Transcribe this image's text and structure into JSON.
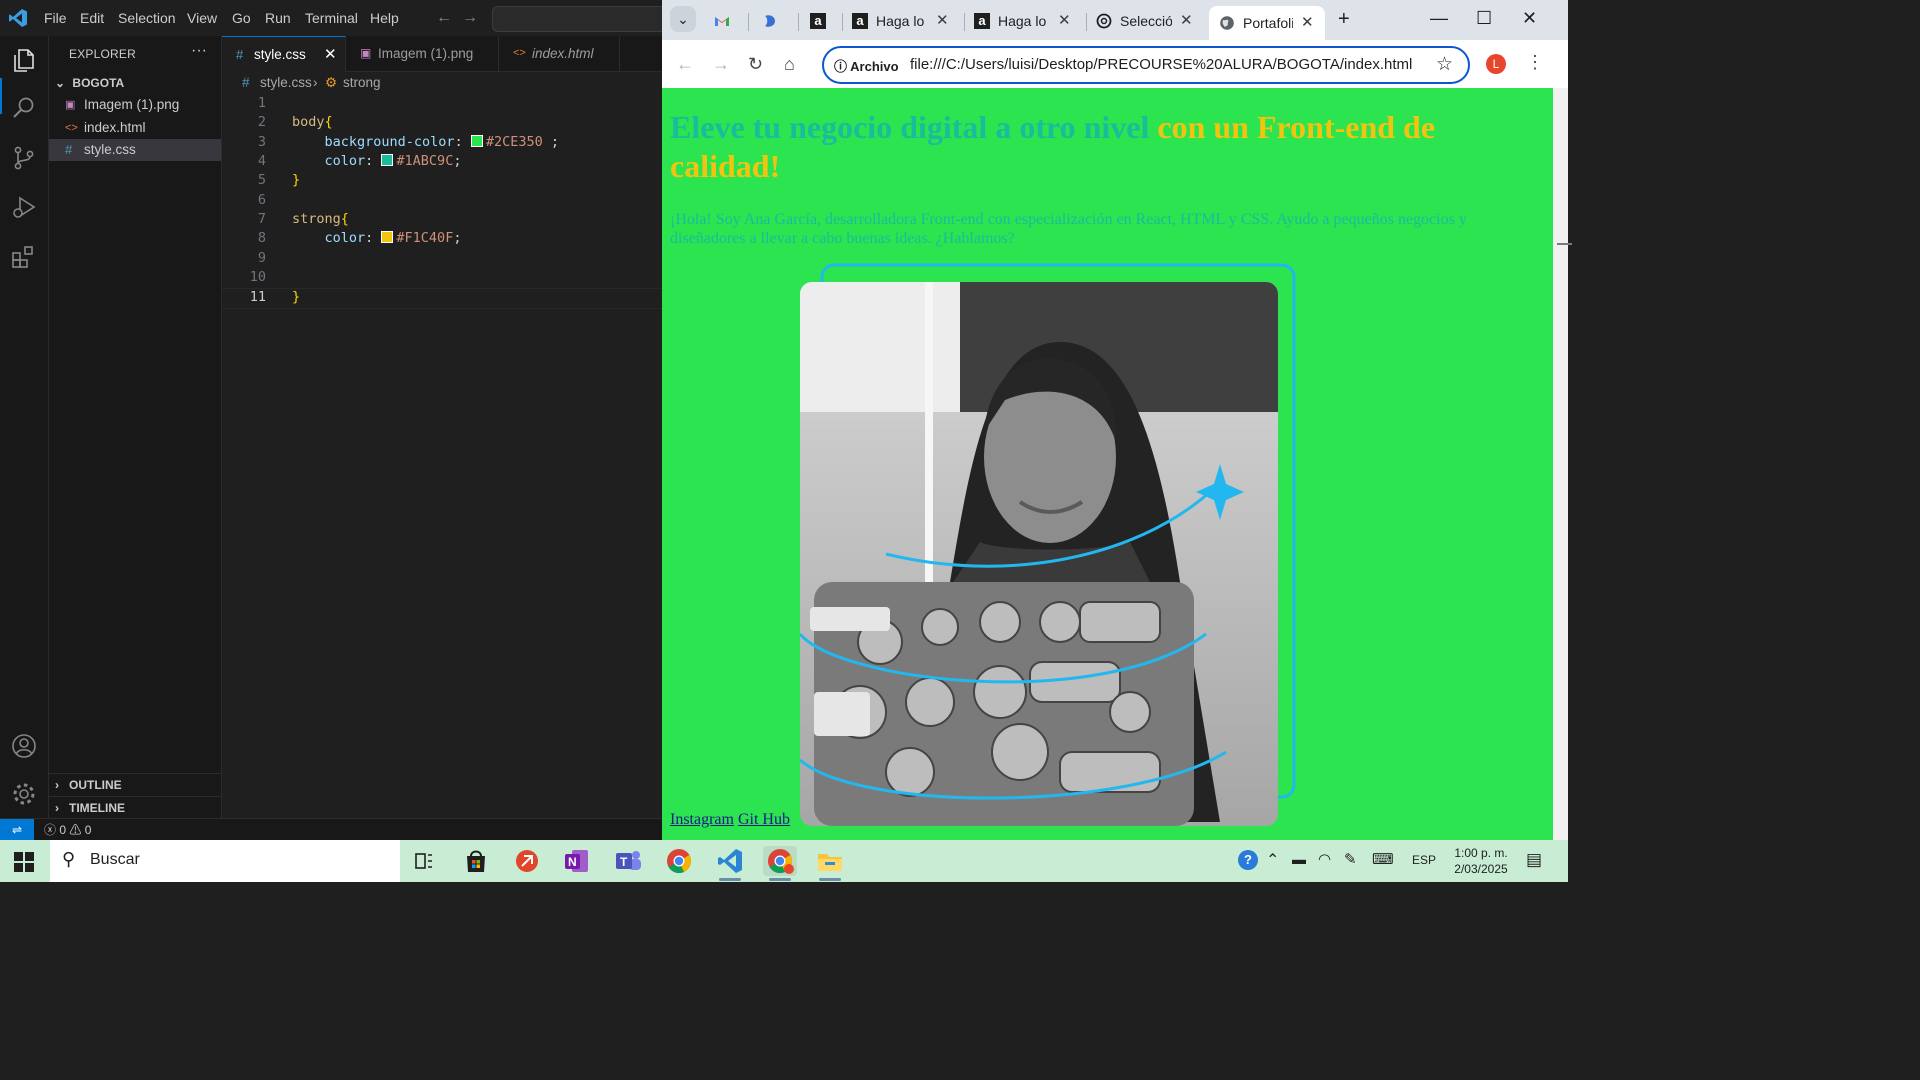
{
  "vscode": {
    "menu": [
      "File",
      "Edit",
      "Selection",
      "View",
      "Go",
      "Run",
      "Terminal",
      "Help"
    ],
    "explorer": {
      "title": "EXPLORER",
      "more": "···",
      "folder": "BOGOTA",
      "files": [
        {
          "name": "Imagem (1).png",
          "icon": "image-file-icon"
        },
        {
          "name": "index.html",
          "icon": "html-file-icon"
        },
        {
          "name": "style.css",
          "icon": "css-file-icon",
          "selected": true
        }
      ],
      "sections": [
        "OUTLINE",
        "TIMELINE"
      ]
    },
    "tabs": [
      {
        "label": "style.css",
        "icon": "css-file-icon",
        "active": true
      },
      {
        "label": "Imagem (1).png",
        "icon": "image-file-icon"
      },
      {
        "label": "index.html",
        "icon": "html-file-icon"
      }
    ],
    "breadcrumb": {
      "file": "style.css",
      "symbol": "strong"
    },
    "code": {
      "line_numbers": [
        "1",
        "2",
        "3",
        "4",
        "5",
        "6",
        "7",
        "8",
        "9",
        "10",
        "11"
      ],
      "l2_selector": "body",
      "l3_prop": "background-color",
      "l3_value": "#2CE350",
      "l3_color": "#2CE350",
      "l4_prop": "color",
      "l4_value": "#1ABC9C",
      "l4_color": "#1ABC9C",
      "l7_selector": "strong",
      "l8_prop": "color",
      "l8_value": "#F1C40F",
      "l8_color": "#F1C40F",
      "active_line": "11"
    },
    "status": {
      "errors": "0",
      "warnings": "0"
    }
  },
  "chrome": {
    "tabs": [
      {
        "title": "",
        "icon": "gmail-icon"
      },
      {
        "title": "",
        "icon": "copilot-icon"
      },
      {
        "title": "",
        "icon": "alura-icon"
      },
      {
        "title": "Haga lo c",
        "icon": "alura-icon"
      },
      {
        "title": "Haga lo c",
        "icon": "alura-icon"
      },
      {
        "title": "Selección",
        "icon": "openai-icon"
      },
      {
        "title": "Portafolio",
        "icon": "globe-icon",
        "active": true
      }
    ],
    "site_info": "Archivo",
    "url": "file:///C:/Users/luisi/Desktop/PRECOURSE%20ALURA/BOGOTA/index.html",
    "profile_initial": "L"
  },
  "page": {
    "headline": "Eleve tu negocio digital a otro nivel ",
    "headline_strong": "con un Front-end de calidad!",
    "paragraph": "¡Hola! Soy Ana García, desarrolladora Front-end con especialización en React, HTML y CSS. Ayudo a pequeños negocios y diseñadores a llevar a cabo buenas ideas. ¿Hablamos?",
    "links": [
      "Instagram",
      "Git Hub"
    ],
    "colors": {
      "background": "#2CE350",
      "text": "#1ABC9C",
      "strong": "#F1C40F",
      "frame": "#22b8ef"
    }
  },
  "taskbar": {
    "search": "Buscar",
    "language": "ESP",
    "time": "1:00 p. m.",
    "date": "2/03/2025"
  }
}
